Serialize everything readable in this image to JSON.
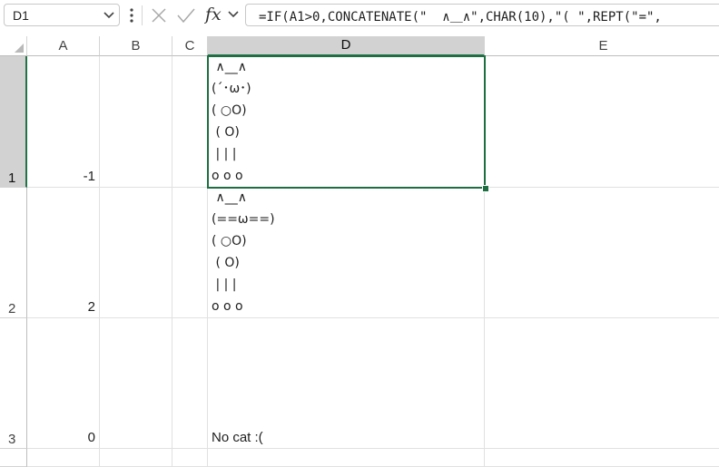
{
  "formula_bar": {
    "name_box": "D1",
    "formula": "=IF(A1>0,CONCATENATE(\"  ∧＿∧\",CHAR(10),\"( \",REPT(\"=\","
  },
  "columns": [
    "A",
    "B",
    "C",
    "D",
    "E"
  ],
  "selected_column": "D",
  "rows": [
    {
      "label": "1",
      "a": "-1",
      "d_lines": " ∧__∧\n(´･ω･)\n( ○O)\n ( O)\n | | |\no o o"
    },
    {
      "label": "2",
      "a": "2",
      "d_lines": " ∧__∧\n(==ω==)\n( ○O)\n ( O)\n | | |\no o o"
    },
    {
      "label": "3",
      "a": "0",
      "d_text": "No cat :("
    }
  ],
  "colors": {
    "selection": "#1e6e42",
    "header_selected": "#d2d2d2",
    "gridline": "#e1e1e1"
  },
  "icons": {
    "namebox_dropdown": "chevron-down-icon",
    "more": "vertical-dots-icon",
    "cancel": "x-icon",
    "enter": "checkmark-icon",
    "function": "fx-icon",
    "expand": "chevron-down-icon"
  }
}
